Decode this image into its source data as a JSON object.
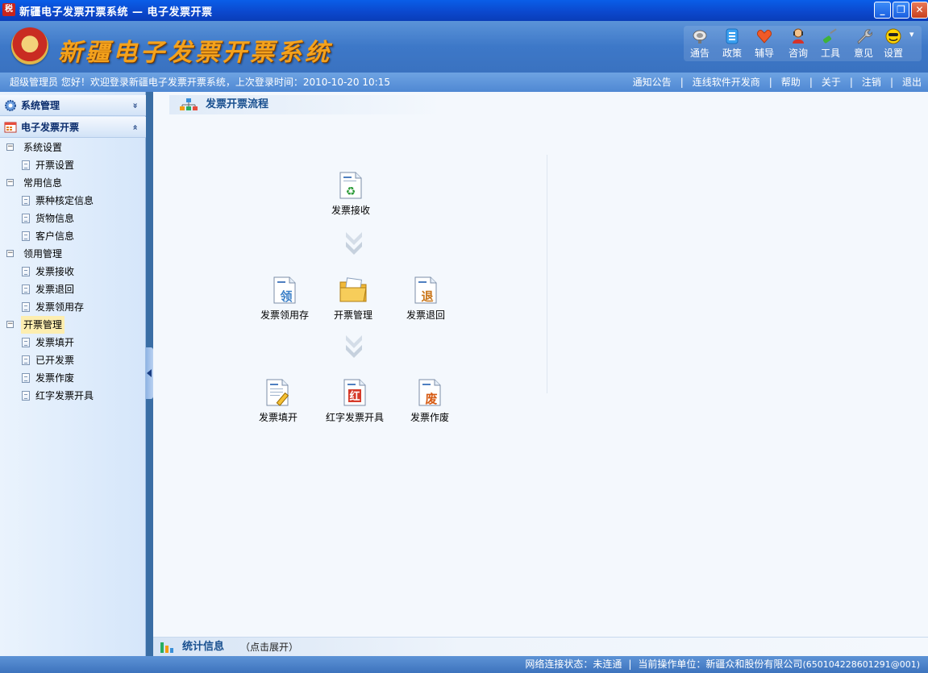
{
  "window": {
    "title": "新疆电子发票开票系统 — 电子发票开票",
    "app_icon_text": "税",
    "minimize": "_",
    "restore": "❐",
    "close": "✕"
  },
  "header": {
    "brand": "新疆电子发票开票系统",
    "tools": [
      {
        "label": "通告"
      },
      {
        "label": "政策"
      },
      {
        "label": "辅导"
      },
      {
        "label": "咨询"
      },
      {
        "label": "工具"
      },
      {
        "label": "意见"
      },
      {
        "label": "设置"
      }
    ],
    "settings_dropdown": "▾"
  },
  "infobar": {
    "welcome": "超级管理员 您好！欢迎登录新疆电子发票开票系统，上次登录时间：2010-10-20 10:15",
    "links": [
      "通知公告",
      "连线软件开发商",
      "帮助",
      "关于",
      "注销",
      "退出"
    ],
    "separator": "|"
  },
  "sidebar": {
    "sections": [
      {
        "title": "系统管理",
        "chevron": "»"
      },
      {
        "title": "电子发票开票",
        "chevron": "«"
      }
    ],
    "tree": [
      {
        "label": "系统设置",
        "type": "group",
        "toggle": "−"
      },
      {
        "label": "开票设置",
        "type": "leaf"
      },
      {
        "label": "常用信息",
        "type": "group",
        "toggle": "−"
      },
      {
        "label": "票种核定信息",
        "type": "leaf"
      },
      {
        "label": "货物信息",
        "type": "leaf"
      },
      {
        "label": "客户信息",
        "type": "leaf"
      },
      {
        "label": "领用管理",
        "type": "group",
        "toggle": "−"
      },
      {
        "label": "发票接收",
        "type": "leaf"
      },
      {
        "label": "发票退回",
        "type": "leaf"
      },
      {
        "label": "发票领用存",
        "type": "leaf"
      },
      {
        "label": "开票管理",
        "type": "group",
        "toggle": "−",
        "highlighted": true
      },
      {
        "label": "发票填开",
        "type": "leaf"
      },
      {
        "label": "已开发票",
        "type": "leaf"
      },
      {
        "label": "发票作废",
        "type": "leaf"
      },
      {
        "label": "红字发票开具",
        "type": "leaf"
      }
    ]
  },
  "main": {
    "tab_title": "发票开票流程",
    "flow": {
      "receive": {
        "label": "发票接收",
        "glyph": "♻"
      },
      "inventory": {
        "label": "发票领用存",
        "glyph": "领"
      },
      "manage": {
        "label": "开票管理",
        "glyph": ""
      },
      "return": {
        "label": "发票退回",
        "glyph": "退"
      },
      "fill": {
        "label": "发票填开",
        "glyph": ""
      },
      "red": {
        "label": "红字发票开具",
        "glyph": "红"
      },
      "void": {
        "label": "发票作废",
        "glyph": "废"
      }
    },
    "stats": {
      "title": "统计信息",
      "hint": "（点击展开）"
    }
  },
  "statusbar": {
    "network_label": "网络连接状态：",
    "network_value": "未连通",
    "unit_label": "当前操作单位：",
    "unit_value": "新疆众和股份有限公司",
    "unit_code": "(650104228601291@001)"
  },
  "colors": {
    "title_bar": "#0b47cc",
    "header": "#3d78c8",
    "brand": "#f4a21c",
    "sidebar": "#eaf3fd",
    "main_bg": "#f4f8fd",
    "highlight": "#fdeeb0"
  }
}
